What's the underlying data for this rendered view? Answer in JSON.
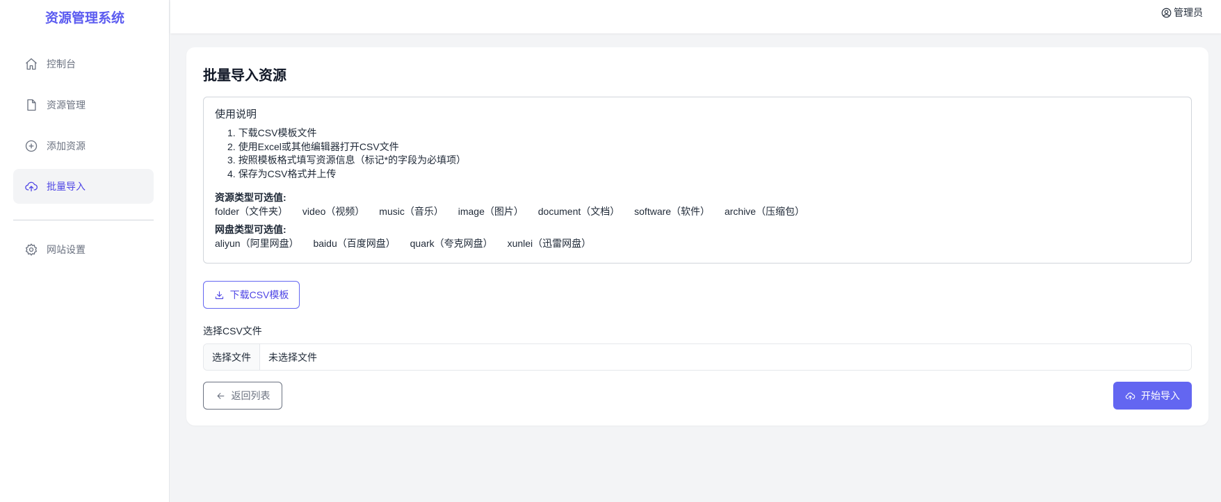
{
  "brand": "资源管理系统",
  "nav": {
    "dashboard": "控制台",
    "resources": "资源管理",
    "add": "添加资源",
    "batch_import": "批量导入",
    "settings": "网站设置"
  },
  "header": {
    "user": "管理员"
  },
  "page": {
    "title": "批量导入资源",
    "instructions": {
      "heading": "使用说明",
      "steps": [
        {
          "num": "1.",
          "text": "下载CSV模板文件"
        },
        {
          "num": "2.",
          "text": "使用Excel或其他编辑器打开CSV文件"
        },
        {
          "num": "3.",
          "text": "按照模板格式填写资源信息（标记*的字段为必填项）"
        },
        {
          "num": "4.",
          "text": "保存为CSV格式并上传"
        }
      ],
      "resource_types_label": "资源类型可选值:",
      "resource_types": [
        "folder（文件夹）",
        "video（视频）",
        "music（音乐）",
        "image（图片）",
        "document（文档）",
        "software（软件）",
        "archive（压缩包）"
      ],
      "disk_types_label": "网盘类型可选值:",
      "disk_types": [
        "aliyun（阿里网盘）",
        "baidu（百度网盘）",
        "quark（夸克网盘）",
        "xunlei（迅雷网盘）"
      ]
    },
    "download_button": "下载CSV模板",
    "file_label": "选择CSV文件",
    "file_button": "选择文件",
    "file_status": "未选择文件",
    "back_button": "返回列表",
    "import_button": "开始导入"
  },
  "colors": {
    "accent": "#6366f1",
    "brand": "#5b5bf0",
    "background": "#f3f4f6"
  }
}
